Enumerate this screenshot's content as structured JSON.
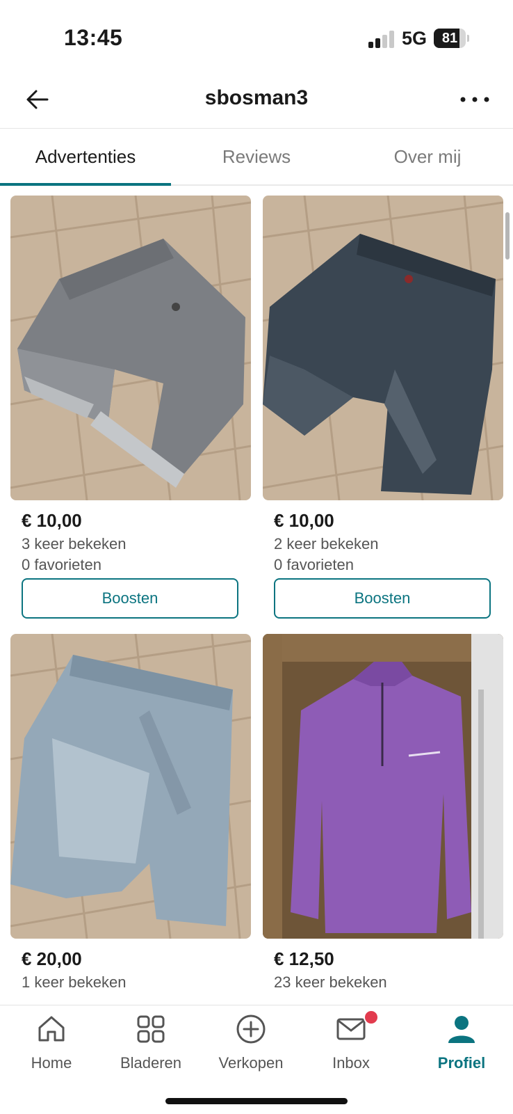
{
  "status_bar": {
    "time": "13:45",
    "network": "5G",
    "battery": "81"
  },
  "header": {
    "title": "sbosman3"
  },
  "tabs": [
    {
      "label": "Advertenties",
      "active": true
    },
    {
      "label": "Reviews",
      "active": false
    },
    {
      "label": "Over mij",
      "active": false
    }
  ],
  "listings": [
    {
      "price": "€ 10,00",
      "views": "3 keer bekeken",
      "favorites": "0 favorieten",
      "button": "Boosten",
      "image": "grey-denim-shorts"
    },
    {
      "price": "€ 10,00",
      "views": "2 keer bekeken",
      "favorites": "0 favorieten",
      "button": "Boosten",
      "image": "dark-denim-shorts"
    },
    {
      "price": "€ 20,00",
      "views": "1 keer bekeken",
      "image": "light-denim-shorts"
    },
    {
      "price": "€ 12,50",
      "views": "23 keer bekeken",
      "image": "purple-quarter-zip"
    }
  ],
  "bottom_nav": [
    {
      "label": "Home",
      "icon": "home-icon"
    },
    {
      "label": "Bladeren",
      "icon": "grid-icon"
    },
    {
      "label": "Verkopen",
      "icon": "plus-circle-icon"
    },
    {
      "label": "Inbox",
      "icon": "mail-icon"
    },
    {
      "label": "Profiel",
      "icon": "profile-icon",
      "active": true
    }
  ],
  "colors": {
    "accent": "#0b7480",
    "badge": "#e23b4e"
  }
}
